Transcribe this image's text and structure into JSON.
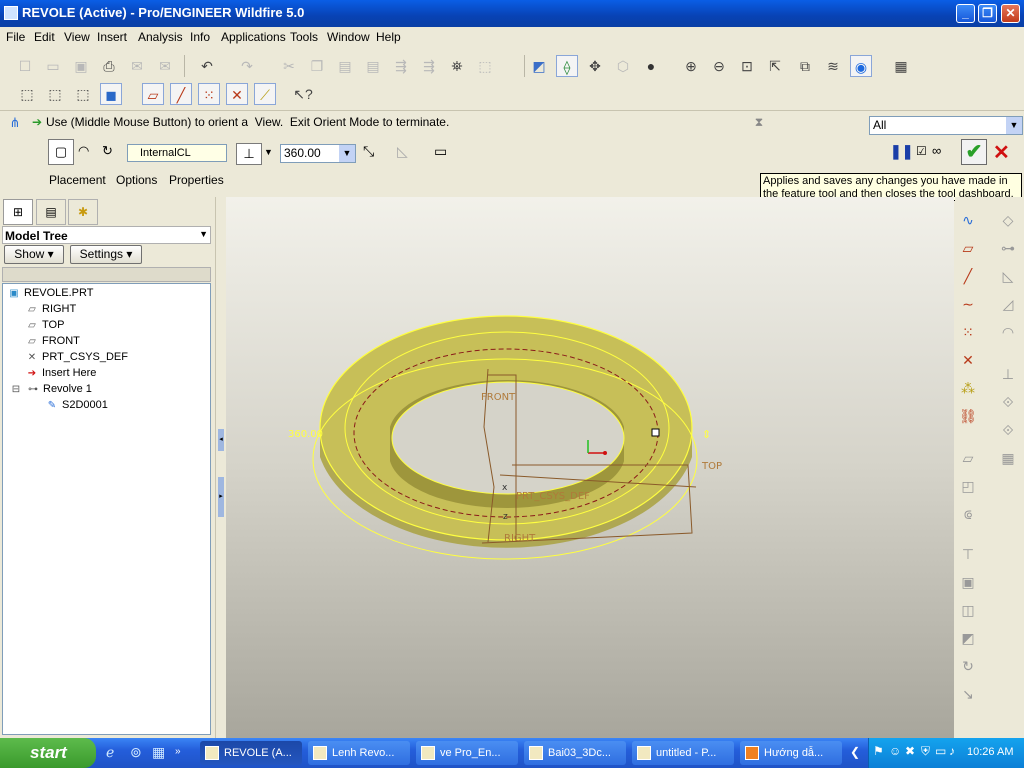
{
  "window": {
    "title": "REVOLE (Active) - Pro/ENGINEER Wildfire 5.0",
    "buttons": {
      "minimize": "_",
      "maximize": "❐",
      "close": "✕"
    }
  },
  "menu": [
    "File",
    "Edit",
    "View",
    "Insert",
    "Analysis",
    "Info",
    "Applications",
    "Tools",
    "Window",
    "Help"
  ],
  "message": "Use (Middle Mouse Button) to orient a  View.  Exit Orient Mode to terminate.",
  "filter": {
    "value": "All"
  },
  "dashboard": {
    "axis_field": "InternalCL",
    "angle_value": "360.00",
    "tabs": [
      "Placement",
      "Options",
      "Properties"
    ]
  },
  "tooltip": "Applies and saves any changes you have made in the feature tool and then closes the tool dashboard.",
  "model_tree": {
    "title": "Model Tree",
    "show_label": "Show",
    "settings_label": "Settings",
    "items": [
      {
        "label": "REVOLE.PRT",
        "icon": "part-icon"
      },
      {
        "label": "RIGHT",
        "icon": "datum-plane-icon"
      },
      {
        "label": "TOP",
        "icon": "datum-plane-icon"
      },
      {
        "label": "FRONT",
        "icon": "datum-plane-icon"
      },
      {
        "label": "PRT_CSYS_DEF",
        "icon": "csys-icon"
      },
      {
        "label": "Insert Here",
        "icon": "insert-arrow-icon"
      },
      {
        "label": "Revolve 1",
        "icon": "revolve-icon"
      },
      {
        "label": "S2D0001",
        "icon": "sketch-icon"
      }
    ]
  },
  "viewport": {
    "labels": {
      "front": "FRONT",
      "top": "TOP",
      "right": "RIGHT",
      "csys": "PRT_CSYS_DEF",
      "angle": "360.00",
      "x": "x",
      "z": "z"
    },
    "colors": {
      "body": "#b5ad4a",
      "edge": "#ffff40",
      "datum": "#8a5a2a",
      "background": "#d5d3c9"
    }
  },
  "taskbar": {
    "start": "start",
    "tasks": [
      "REVOLE (A...",
      "Lenh Revo...",
      "ve Pro_En...",
      "Bai03_3Dc...",
      "untitled - P...",
      "Hướng dẫ..."
    ],
    "clock": "10:26 AM"
  }
}
